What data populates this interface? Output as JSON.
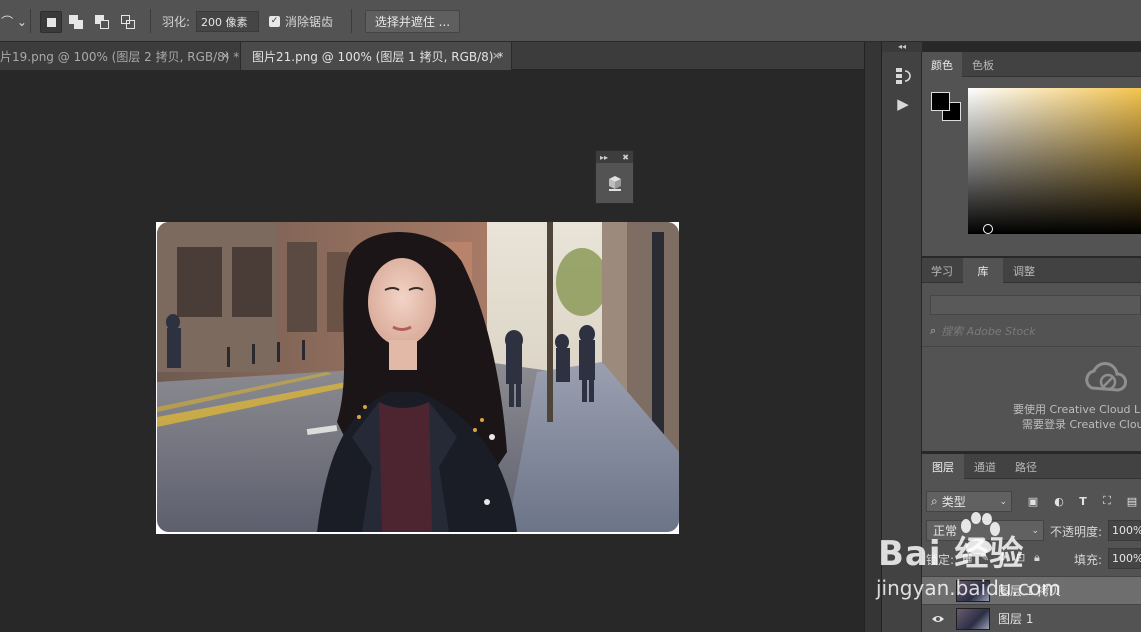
{
  "options_bar": {
    "tool_glyph": "⌒ ⌄",
    "feather_label": "羽化:",
    "feather_value": "200 像素",
    "antialias_label": "消除锯齿",
    "antialias_checked": "✓",
    "select_mask_label": "选择并遮住 ..."
  },
  "tabs": [
    {
      "label": "片19.png @ 100% (图层 2 拷贝, RGB/8) *",
      "close": "×",
      "active": false
    },
    {
      "label": "图片21.png @ 100% (图层 1 拷贝, RGB/8) *",
      "close": "×",
      "active": true
    }
  ],
  "floating_panel": {
    "collapse": "▸▸",
    "close": "✖"
  },
  "dock": {
    "collapse": "◂◂",
    "play": "▶"
  },
  "color_panel": {
    "tabs": [
      "颜色",
      "色板"
    ],
    "foreground": "#000000",
    "background": "#000000",
    "hue": "#f4c44e"
  },
  "library_panel": {
    "tabs": [
      "学习",
      "库",
      "调整"
    ],
    "search_placeholder": "搜索 Adobe Stock",
    "message_line1": "要使用 Creative Cloud Li",
    "message_line2": "需要登录 Creative Clou"
  },
  "layers_panel": {
    "tabs": [
      "图层",
      "通道",
      "路径"
    ],
    "kind_filter": "类型",
    "blend_mode": "正常",
    "opacity_label": "不透明度:",
    "opacity_value": "100%",
    "lock_label": "锁定:",
    "fill_label": "填充:",
    "fill_value": "100%",
    "layers": [
      {
        "name": "图层 1 拷贝",
        "selected": true
      },
      {
        "name": "图层 1",
        "selected": false
      }
    ]
  },
  "watermark": {
    "main": "Bai 经验",
    "sub": "jingyan.baidu.com"
  }
}
